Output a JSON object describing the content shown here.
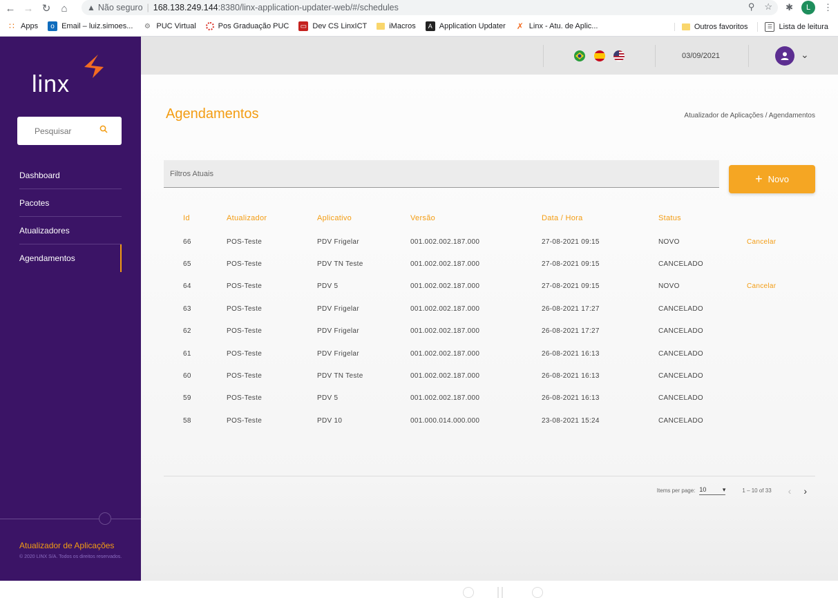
{
  "browser": {
    "security": "Não seguro",
    "url_host": "168.138.249.144",
    "url_path": ":8380/linx-application-updater-web/#/schedules",
    "profile_initial": "L",
    "bookmarks": [
      {
        "label": "Apps",
        "icon": "apps-grid-icon"
      },
      {
        "label": "Email – luiz.simoes...",
        "icon": "outlook-icon"
      },
      {
        "label": "PUC Virtual",
        "icon": "puc-icon"
      },
      {
        "label": "Pos Graduação PUC",
        "icon": "ring-icon"
      },
      {
        "label": "Dev CS LinxICT",
        "icon": "oracle-icon"
      },
      {
        "label": "iMacros",
        "icon": "folder-icon"
      },
      {
        "label": "Application Updater",
        "icon": "angular-icon"
      },
      {
        "label": "Linx - Atu. de Aplic...",
        "icon": "linx-icon"
      }
    ],
    "bookmarks_right": [
      {
        "label": "Outros favoritos",
        "icon": "folder-icon"
      },
      {
        "label": "Lista de leitura",
        "icon": "reading-list-icon"
      }
    ]
  },
  "sidebar": {
    "logo": "linx",
    "search_placeholder": "Pesquisar",
    "items": [
      {
        "label": "Dashboard"
      },
      {
        "label": "Pacotes"
      },
      {
        "label": "Atualizadores"
      },
      {
        "label": "Agendamentos",
        "active": true
      }
    ],
    "app_name": "Atualizador de Aplicações",
    "copyright": "© 2020 LINX S/A. Todos os direitos reservados."
  },
  "header": {
    "date": "03/09/2021",
    "flags": [
      "brazil-flag-icon",
      "spain-flag-icon",
      "usa-flag-icon"
    ]
  },
  "page": {
    "title": "Agendamentos",
    "breadcrumb": "Atualizador de Aplicações / Agendamentos",
    "filters_label": "Filtros Atuais",
    "new_button": "Novo"
  },
  "table": {
    "headers": [
      "Id",
      "Atualizador",
      "Aplicativo",
      "Versão",
      "Data / Hora",
      "Status"
    ],
    "rows": [
      {
        "id": "66",
        "atualizador": "POS-Teste",
        "aplicativo": "PDV Frigelar",
        "versao": "001.002.002.187.000",
        "data": "27-08-2021 09:15",
        "status": "NOVO",
        "action": "Cancelar"
      },
      {
        "id": "65",
        "atualizador": "POS-Teste",
        "aplicativo": "PDV TN Teste",
        "versao": "001.002.002.187.000",
        "data": "27-08-2021 09:15",
        "status": "CANCELADO",
        "action": ""
      },
      {
        "id": "64",
        "atualizador": "POS-Teste",
        "aplicativo": "PDV 5",
        "versao": "001.002.002.187.000",
        "data": "27-08-2021 09:15",
        "status": "NOVO",
        "action": "Cancelar"
      },
      {
        "id": "63",
        "atualizador": "POS-Teste",
        "aplicativo": "PDV Frigelar",
        "versao": "001.002.002.187.000",
        "data": "26-08-2021 17:27",
        "status": "CANCELADO",
        "action": ""
      },
      {
        "id": "62",
        "atualizador": "POS-Teste",
        "aplicativo": "PDV Frigelar",
        "versao": "001.002.002.187.000",
        "data": "26-08-2021 17:27",
        "status": "CANCELADO",
        "action": ""
      },
      {
        "id": "61",
        "atualizador": "POS-Teste",
        "aplicativo": "PDV Frigelar",
        "versao": "001.002.002.187.000",
        "data": "26-08-2021 16:13",
        "status": "CANCELADO",
        "action": ""
      },
      {
        "id": "60",
        "atualizador": "POS-Teste",
        "aplicativo": "PDV TN Teste",
        "versao": "001.002.002.187.000",
        "data": "26-08-2021 16:13",
        "status": "CANCELADO",
        "action": ""
      },
      {
        "id": "59",
        "atualizador": "POS-Teste",
        "aplicativo": "PDV 5",
        "versao": "001.002.002.187.000",
        "data": "26-08-2021 16:13",
        "status": "CANCELADO",
        "action": ""
      },
      {
        "id": "58",
        "atualizador": "POS-Teste",
        "aplicativo": "PDV 10",
        "versao": "001.000.014.000.000",
        "data": "23-08-2021 15:24",
        "status": "CANCELADO",
        "action": ""
      }
    ]
  },
  "pagination": {
    "items_per_page_label": "Items per page:",
    "items_per_page_value": "10",
    "range": "1 – 10 of 33"
  },
  "colors": {
    "sidebar": "#3b1466",
    "accent": "#f39c12"
  }
}
